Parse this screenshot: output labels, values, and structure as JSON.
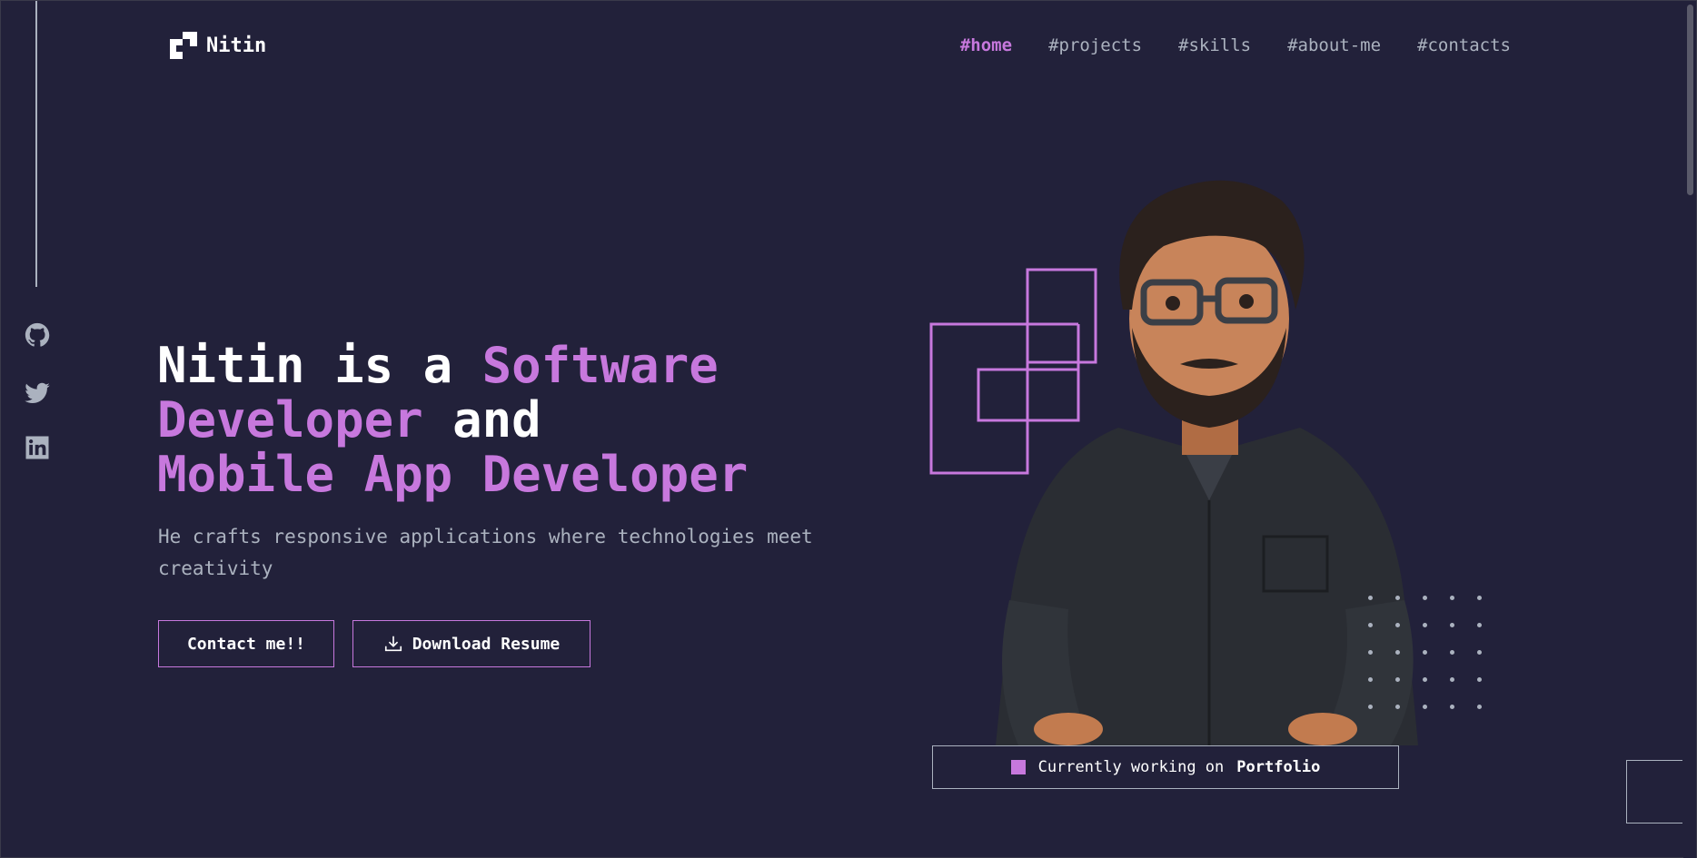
{
  "brand": {
    "name": "Nitin",
    "logo_icon": "logo-mark-icon"
  },
  "nav": {
    "items": [
      {
        "label": "#home",
        "active": true
      },
      {
        "label": "#projects",
        "active": false
      },
      {
        "label": "#skills",
        "active": false
      },
      {
        "label": "#about-me",
        "active": false
      },
      {
        "label": "#contacts",
        "active": false
      }
    ]
  },
  "social": [
    {
      "icon": "github-icon"
    },
    {
      "icon": "twitter-icon"
    },
    {
      "icon": "linkedin-icon"
    }
  ],
  "hero": {
    "line1_part1": "Nitin is a ",
    "line1_accent": "Software",
    "line2_accent": "Developer",
    "line2_part2": " and",
    "line3_accent": "Mobile App Developer",
    "subtext": "He crafts responsive applications where technologies meet creativity",
    "contact_button": "Contact me!!",
    "resume_button": "Download Resume"
  },
  "status": {
    "prefix": "Currently working on",
    "project": "Portfolio"
  },
  "colors": {
    "accent": "#c778dd",
    "background": "#22213a",
    "text_muted": "#abb2bf",
    "text": "#ffffff"
  }
}
